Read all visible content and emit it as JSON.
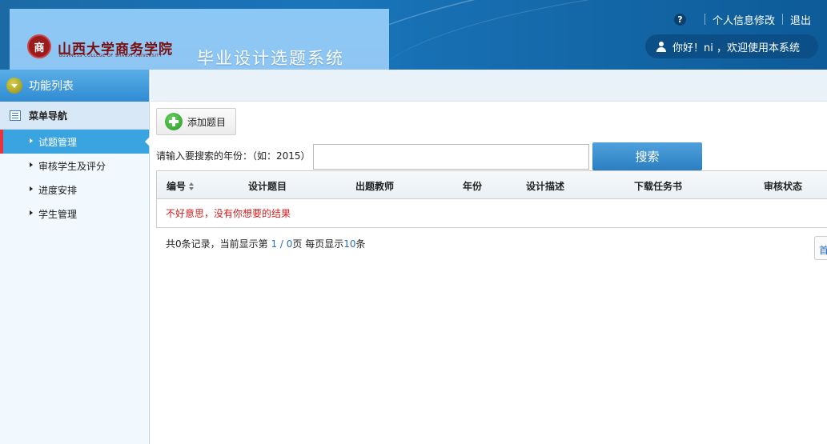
{
  "header": {
    "logo_seal": "商",
    "logo_text": "山西大学商务学院",
    "logo_subtitle": "BUSINESS COLLEGE OF SHANXI UNIVERSITY",
    "system_title": "毕业设计选题系统",
    "help_icon": "?",
    "profile_link": "个人信息修改",
    "logout_link": "退出",
    "welcome": "你好！ni ，欢迎使用本系统"
  },
  "sidebar": {
    "function_list": "功能列表",
    "menu_nav": "菜单导航",
    "items": [
      {
        "label": "试题管理",
        "active": true
      },
      {
        "label": "审核学生及评分",
        "active": false
      },
      {
        "label": "进度安排",
        "active": false
      },
      {
        "label": "学生管理",
        "active": false
      }
    ]
  },
  "toolbar": {
    "add_label": "添加题目"
  },
  "search": {
    "label": "请输入要搜索的年份：（如：2015）",
    "value": "",
    "button": "搜索"
  },
  "table": {
    "columns": [
      "编号",
      "设计题目",
      "出题教师",
      "年份",
      "设计描述",
      "下载任务书",
      "审核状态"
    ],
    "empty_message": "不好意思，没有你想要的结果"
  },
  "pager": {
    "prefix": "共0条记录，当前显示第 ",
    "current": "1",
    "slash": " / ",
    "total": "0",
    "suffix_pages": "页 每页显示",
    "per_page": "10",
    "suffix_items": "条",
    "first": "首页"
  },
  "colors": {
    "header_blue": "#1a75bb",
    "banner_blue": "#8cc8f6",
    "active_item": "#3aa4e0",
    "active_marker": "#e8323c",
    "search_button": "#3a8fcf",
    "empty_text": "#d02020"
  },
  "icons": {
    "help": "question-icon",
    "user": "user-icon",
    "function_list": "chevron-down-circle-icon",
    "menu_nav": "list-icon",
    "menu_arrow": "caret-right-icon",
    "add": "plus-circle-icon",
    "sort": "sort-icon"
  }
}
